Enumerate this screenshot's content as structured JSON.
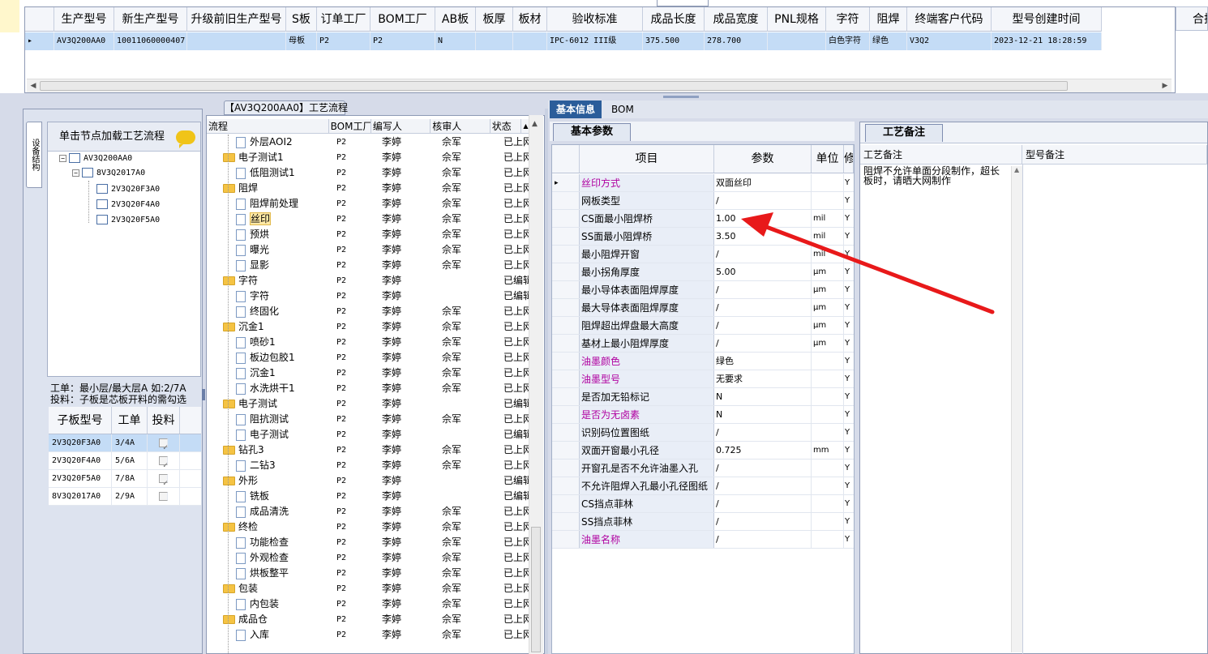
{
  "top_grid": {
    "headers": [
      "生产型号",
      "新生产型号",
      "升级前旧生产型号",
      "S板",
      "订单工厂",
      "BOM工厂",
      "AB板",
      "板厚",
      "板材",
      "验收标准",
      "成品长度",
      "成品宽度",
      "PNL规格",
      "字符",
      "阻焊",
      "终端客户代码",
      "型号创建时间"
    ],
    "row": [
      "AV3Q200AA0",
      "10011060000407",
      "",
      "母板",
      "P2",
      "P2",
      "N",
      "",
      "",
      "IPC-6012 III级",
      "375.500",
      "278.700",
      "",
      "白色字符",
      "绿色",
      "V3Q2",
      "2023-12-21 18:28:59"
    ],
    "right_header": "合挂"
  },
  "left_panel": {
    "vertical_tab": "设备结构",
    "tree_header": "单击节点加载工艺流程",
    "tree_nodes": [
      "AV3Q200AA0",
      "8V3Q2017A0",
      "2V3Q20F3A0",
      "2V3Q20F4A0",
      "2V3Q20F5A0"
    ],
    "info_line1": "工单：最小层/最大层A 如:2/7A",
    "info_line2": "投料：子板是芯板开料的需勾选",
    "sub_headers": [
      "子板型号",
      "工单",
      "投料"
    ],
    "sub_rows": [
      {
        "model": "2V3Q20F3A0",
        "order": "3/4A",
        "checked": "✓"
      },
      {
        "model": "2V3Q20F4A0",
        "order": "5/6A",
        "checked": "✓"
      },
      {
        "model": "2V3Q20F5A0",
        "order": "7/8A",
        "checked": "✓"
      },
      {
        "model": "8V3Q2017A0",
        "order": "2/9A",
        "checked": ""
      }
    ]
  },
  "middle_panel": {
    "title": "【AV3Q200AA0】工艺流程",
    "headers": [
      "流程",
      "BOM工厂",
      "编写人",
      "核审人",
      "状态"
    ],
    "rows": [
      {
        "name": "外层AOI2",
        "level": 1,
        "bom": "P2",
        "writer": "李婷",
        "reviewer": "佘军",
        "status": "已上网"
      },
      {
        "name": "电子测试1",
        "level": 0,
        "bom": "P2",
        "writer": "李婷",
        "reviewer": "佘军",
        "status": "已上网"
      },
      {
        "name": "低阻测试1",
        "level": 1,
        "bom": "P2",
        "writer": "李婷",
        "reviewer": "佘军",
        "status": "已上网"
      },
      {
        "name": "阻焊",
        "level": 0,
        "bom": "P2",
        "writer": "李婷",
        "reviewer": "佘军",
        "status": "已上网"
      },
      {
        "name": "阻焊前处理",
        "level": 1,
        "bom": "P2",
        "writer": "李婷",
        "reviewer": "佘军",
        "status": "已上网"
      },
      {
        "name": "丝印",
        "level": 1,
        "bom": "P2",
        "writer": "李婷",
        "reviewer": "佘军",
        "status": "已上网"
      },
      {
        "name": "预烘",
        "level": 1,
        "bom": "P2",
        "writer": "李婷",
        "reviewer": "佘军",
        "status": "已上网"
      },
      {
        "name": "曝光",
        "level": 1,
        "bom": "P2",
        "writer": "李婷",
        "reviewer": "佘军",
        "status": "已上网"
      },
      {
        "name": "显影",
        "level": 1,
        "bom": "P2",
        "writer": "李婷",
        "reviewer": "佘军",
        "status": "已上网"
      },
      {
        "name": "字符",
        "level": 0,
        "bom": "P2",
        "writer": "李婷",
        "reviewer": "",
        "status": "已编辑"
      },
      {
        "name": "字符",
        "level": 1,
        "bom": "P2",
        "writer": "李婷",
        "reviewer": "",
        "status": "已编辑"
      },
      {
        "name": "终固化",
        "level": 1,
        "bom": "P2",
        "writer": "李婷",
        "reviewer": "佘军",
        "status": "已上网"
      },
      {
        "name": "沉金1",
        "level": 0,
        "bom": "P2",
        "writer": "李婷",
        "reviewer": "佘军",
        "status": "已上网"
      },
      {
        "name": "喷砂1",
        "level": 1,
        "bom": "P2",
        "writer": "李婷",
        "reviewer": "佘军",
        "status": "已上网"
      },
      {
        "name": "板边包胶1",
        "level": 1,
        "bom": "P2",
        "writer": "李婷",
        "reviewer": "佘军",
        "status": "已上网"
      },
      {
        "name": "沉金1",
        "level": 1,
        "bom": "P2",
        "writer": "李婷",
        "reviewer": "佘军",
        "status": "已上网"
      },
      {
        "name": "水洗烘干1",
        "level": 1,
        "bom": "P2",
        "writer": "李婷",
        "reviewer": "佘军",
        "status": "已上网"
      },
      {
        "name": "电子测试",
        "level": 0,
        "bom": "P2",
        "writer": "李婷",
        "reviewer": "",
        "status": "已编辑"
      },
      {
        "name": "阻抗测试",
        "level": 1,
        "bom": "P2",
        "writer": "李婷",
        "reviewer": "佘军",
        "status": "已上网"
      },
      {
        "name": "电子测试",
        "level": 1,
        "bom": "P2",
        "writer": "李婷",
        "reviewer": "",
        "status": "已编辑"
      },
      {
        "name": "钻孔3",
        "level": 0,
        "bom": "P2",
        "writer": "李婷",
        "reviewer": "佘军",
        "status": "已上网"
      },
      {
        "name": "二钻3",
        "level": 1,
        "bom": "P2",
        "writer": "李婷",
        "reviewer": "佘军",
        "status": "已上网"
      },
      {
        "name": "外形",
        "level": 0,
        "bom": "P2",
        "writer": "李婷",
        "reviewer": "",
        "status": "已编辑"
      },
      {
        "name": "铣板",
        "level": 1,
        "bom": "P2",
        "writer": "李婷",
        "reviewer": "",
        "status": "已编辑"
      },
      {
        "name": "成品清洗",
        "level": 1,
        "bom": "P2",
        "writer": "李婷",
        "reviewer": "佘军",
        "status": "已上网"
      },
      {
        "name": "终检",
        "level": 0,
        "bom": "P2",
        "writer": "李婷",
        "reviewer": "佘军",
        "status": "已上网"
      },
      {
        "name": "功能检查",
        "level": 1,
        "bom": "P2",
        "writer": "李婷",
        "reviewer": "佘军",
        "status": "已上网"
      },
      {
        "name": "外观检查",
        "level": 1,
        "bom": "P2",
        "writer": "李婷",
        "reviewer": "佘军",
        "status": "已上网"
      },
      {
        "name": "烘板整平",
        "level": 1,
        "bom": "P2",
        "writer": "李婷",
        "reviewer": "佘军",
        "status": "已上网"
      },
      {
        "name": "包装",
        "level": 0,
        "bom": "P2",
        "writer": "李婷",
        "reviewer": "佘军",
        "status": "已上网"
      },
      {
        "name": "内包装",
        "level": 1,
        "bom": "P2",
        "writer": "李婷",
        "reviewer": "佘军",
        "status": "已上网"
      },
      {
        "name": "成品仓",
        "level": 0,
        "bom": "P2",
        "writer": "李婷",
        "reviewer": "佘军",
        "status": "已上网"
      },
      {
        "name": "入库",
        "level": 1,
        "bom": "P2",
        "writer": "李婷",
        "reviewer": "佘军",
        "status": "已上网"
      }
    ],
    "selected": "丝印"
  },
  "right_panel": {
    "tabs": [
      "基本信息",
      "BOM"
    ],
    "basic_tab": "基本参数",
    "basic_headers": [
      "",
      "项目",
      "参数",
      "单位",
      "修"
    ],
    "basic_rows": [
      {
        "item": "丝印方式",
        "param": "双面丝印",
        "unit": "",
        "flag": "Y",
        "purple": true
      },
      {
        "item": "网板类型",
        "param": "/",
        "unit": "",
        "flag": "Y",
        "purple": false
      },
      {
        "item": "CS面最小阻焊桥",
        "param": "1.00",
        "unit": "mil",
        "flag": "Y",
        "purple": false
      },
      {
        "item": "SS面最小阻焊桥",
        "param": "3.50",
        "unit": "mil",
        "flag": "Y",
        "purple": false
      },
      {
        "item": "最小阻焊开窗",
        "param": "/",
        "unit": "mil",
        "flag": "Y",
        "purple": false
      },
      {
        "item": "最小拐角厚度",
        "param": "5.00",
        "unit": "μm",
        "flag": "Y",
        "purple": false
      },
      {
        "item": "最小导体表面阻焊厚度",
        "param": "/",
        "unit": "μm",
        "flag": "Y",
        "purple": false
      },
      {
        "item": "最大导体表面阻焊厚度",
        "param": "/",
        "unit": "μm",
        "flag": "Y",
        "purple": false
      },
      {
        "item": "阻焊超出焊盘最大高度",
        "param": "/",
        "unit": "μm",
        "flag": "Y",
        "purple": false
      },
      {
        "item": "基材上最小阻焊厚度",
        "param": "/",
        "unit": "μm",
        "flag": "Y",
        "purple": false
      },
      {
        "item": "油墨颜色",
        "param": "绿色",
        "unit": "",
        "flag": "Y",
        "purple": true
      },
      {
        "item": "油墨型号",
        "param": "无要求",
        "unit": "",
        "flag": "Y",
        "purple": true
      },
      {
        "item": "是否加无铅标记",
        "param": "N",
        "unit": "",
        "flag": "Y",
        "purple": false
      },
      {
        "item": "是否为无卤素",
        "param": "N",
        "unit": "",
        "flag": "Y",
        "purple": true
      },
      {
        "item": "识别码位置图纸",
        "param": "/",
        "unit": "",
        "flag": "Y",
        "purple": false
      },
      {
        "item": "双面开窗最小孔径",
        "param": "0.725",
        "unit": "mm",
        "flag": "Y",
        "purple": false
      },
      {
        "item": "开窗孔是否不允许油墨入孔",
        "param": "/",
        "unit": "",
        "flag": "Y",
        "purple": false
      },
      {
        "item": "不允许阻焊入孔最小孔径图纸",
        "param": "/",
        "unit": "",
        "flag": "Y",
        "purple": false
      },
      {
        "item": "CS挡点菲林",
        "param": "/",
        "unit": "",
        "flag": "Y",
        "purple": false
      },
      {
        "item": "SS挡点菲林",
        "param": "/",
        "unit": "",
        "flag": "Y",
        "purple": false
      },
      {
        "item": "油墨名称",
        "param": "/",
        "unit": "",
        "flag": "Y",
        "purple": true
      }
    ],
    "craft_tab": "工艺备注",
    "craft_headers": [
      "工艺备注",
      "型号备注"
    ],
    "craft_note": "阻焊不允许单面分段制作，超长\n板时，请晒大网制作"
  },
  "colors": {
    "accent": "#2b5d9a",
    "selected_row": "#c4dcf6",
    "arrow": "#e8191a",
    "purple": "#b000a0"
  }
}
